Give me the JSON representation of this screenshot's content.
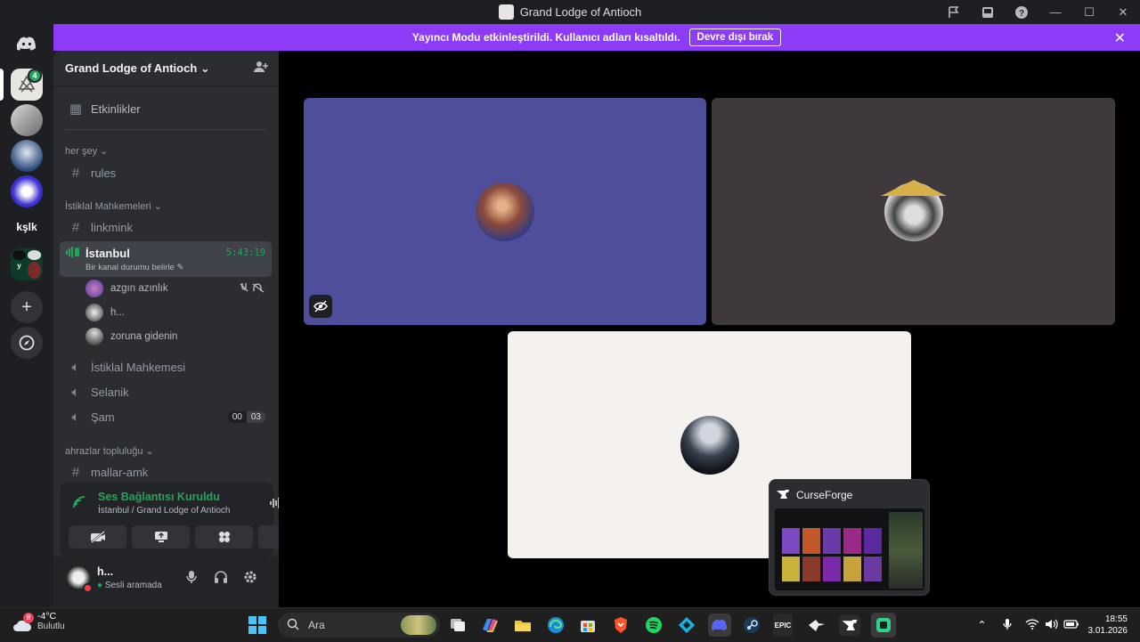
{
  "window": {
    "title": "Grand Lodge of Antioch"
  },
  "servers": {
    "home_icon": "discord-logo-icon",
    "text_server_label": "kşlk",
    "notification_count": "4",
    "add_server_icon": "plus-icon",
    "discover_icon": "compass-icon"
  },
  "banner": {
    "message": "Yayıncı Modu etkinleştirildi. Kullanıcı adları kısaltıldı.",
    "button_label": "Devre dışı bırak",
    "close_symbol": "✕"
  },
  "guild": {
    "name": "Grand Lodge of Antioch",
    "events_label": "Etkinlikler",
    "categories": [
      {
        "name": "her şey",
        "channels": [
          "rules"
        ]
      },
      {
        "name": "İstiklal Mahkemeleri",
        "channels": [
          "linkmink"
        ]
      },
      {
        "name": "ahrazlar topluluğu",
        "channels": [
          "mallar-amk"
        ]
      }
    ],
    "active_voice": {
      "name": "İstanbul",
      "subtitle": "Bir kanal durumu belirle",
      "timer": "5:43:19",
      "users": [
        "azgın azınlık",
        "h...",
        "zoruna gidenin"
      ]
    },
    "voice_channels": [
      {
        "name": "İstiklal Mahkemesi"
      },
      {
        "name": "Selanik"
      },
      {
        "name": "Şam",
        "badge_left": "00",
        "badge_right": "03"
      }
    ]
  },
  "voice_panel": {
    "title": "Ses Bağlantısı Kuruldu",
    "subtitle": "İstanbul / Grand Lodge of Antioch"
  },
  "user_panel": {
    "name": "h...",
    "status": "Sesli aramada"
  },
  "popup": {
    "title": "CurseForge"
  },
  "taskbar": {
    "weather_temp": "-4°C",
    "weather_desc": "Bulutlu",
    "weather_badge": "8",
    "search_placeholder": "Ara",
    "time": "18:55",
    "date": "3.01.2026"
  },
  "colors": {
    "banner": "#8c3cf7",
    "tile_1": "#4e4e9a",
    "tile_2": "#3f393e",
    "tile_3": "#f4f1ef",
    "connected_green": "#23a55a"
  }
}
